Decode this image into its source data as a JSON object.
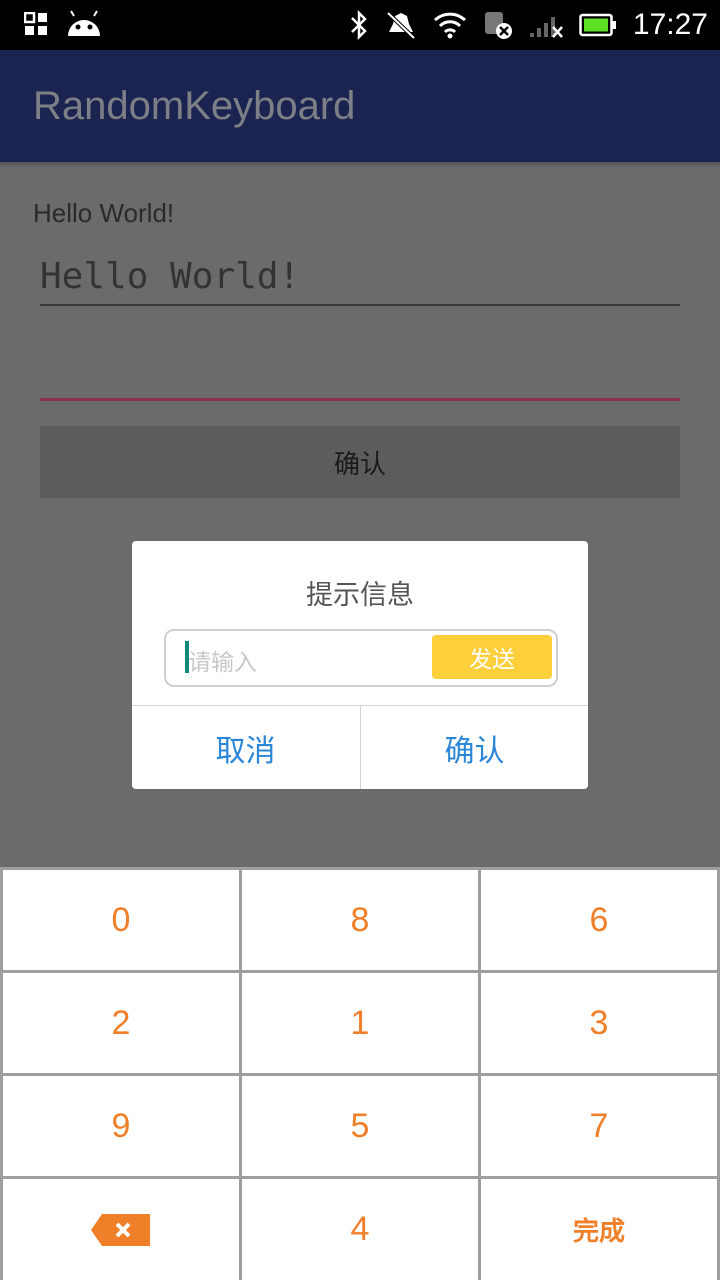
{
  "status_bar": {
    "time": "17:27",
    "icons": [
      "notification-grid-icon",
      "android-icon",
      "bluetooth-icon",
      "mute-icon",
      "wifi-icon",
      "sim-icon",
      "signal-icon",
      "battery-icon"
    ]
  },
  "app_bar": {
    "title": "RandomKeyboard"
  },
  "main": {
    "hello_label": "Hello World!",
    "edit_text_value": "Hello World!",
    "password_value": "",
    "confirm_label": "确认"
  },
  "dialog": {
    "title": "提示信息",
    "input_placeholder": "请输入",
    "send_label": "发送",
    "cancel_label": "取消",
    "ok_label": "确认"
  },
  "keyboard": {
    "keys": [
      "0",
      "8",
      "6",
      "2",
      "1",
      "3",
      "9",
      "5",
      "7"
    ],
    "bottom": {
      "digit": "4",
      "done_label": "完成"
    }
  },
  "colors": {
    "app_bar": "#1b2451",
    "accent_orange": "#f07f2a",
    "dialog_button_blue": "#2b86d8",
    "send_yellow": "#fdcf3a"
  }
}
